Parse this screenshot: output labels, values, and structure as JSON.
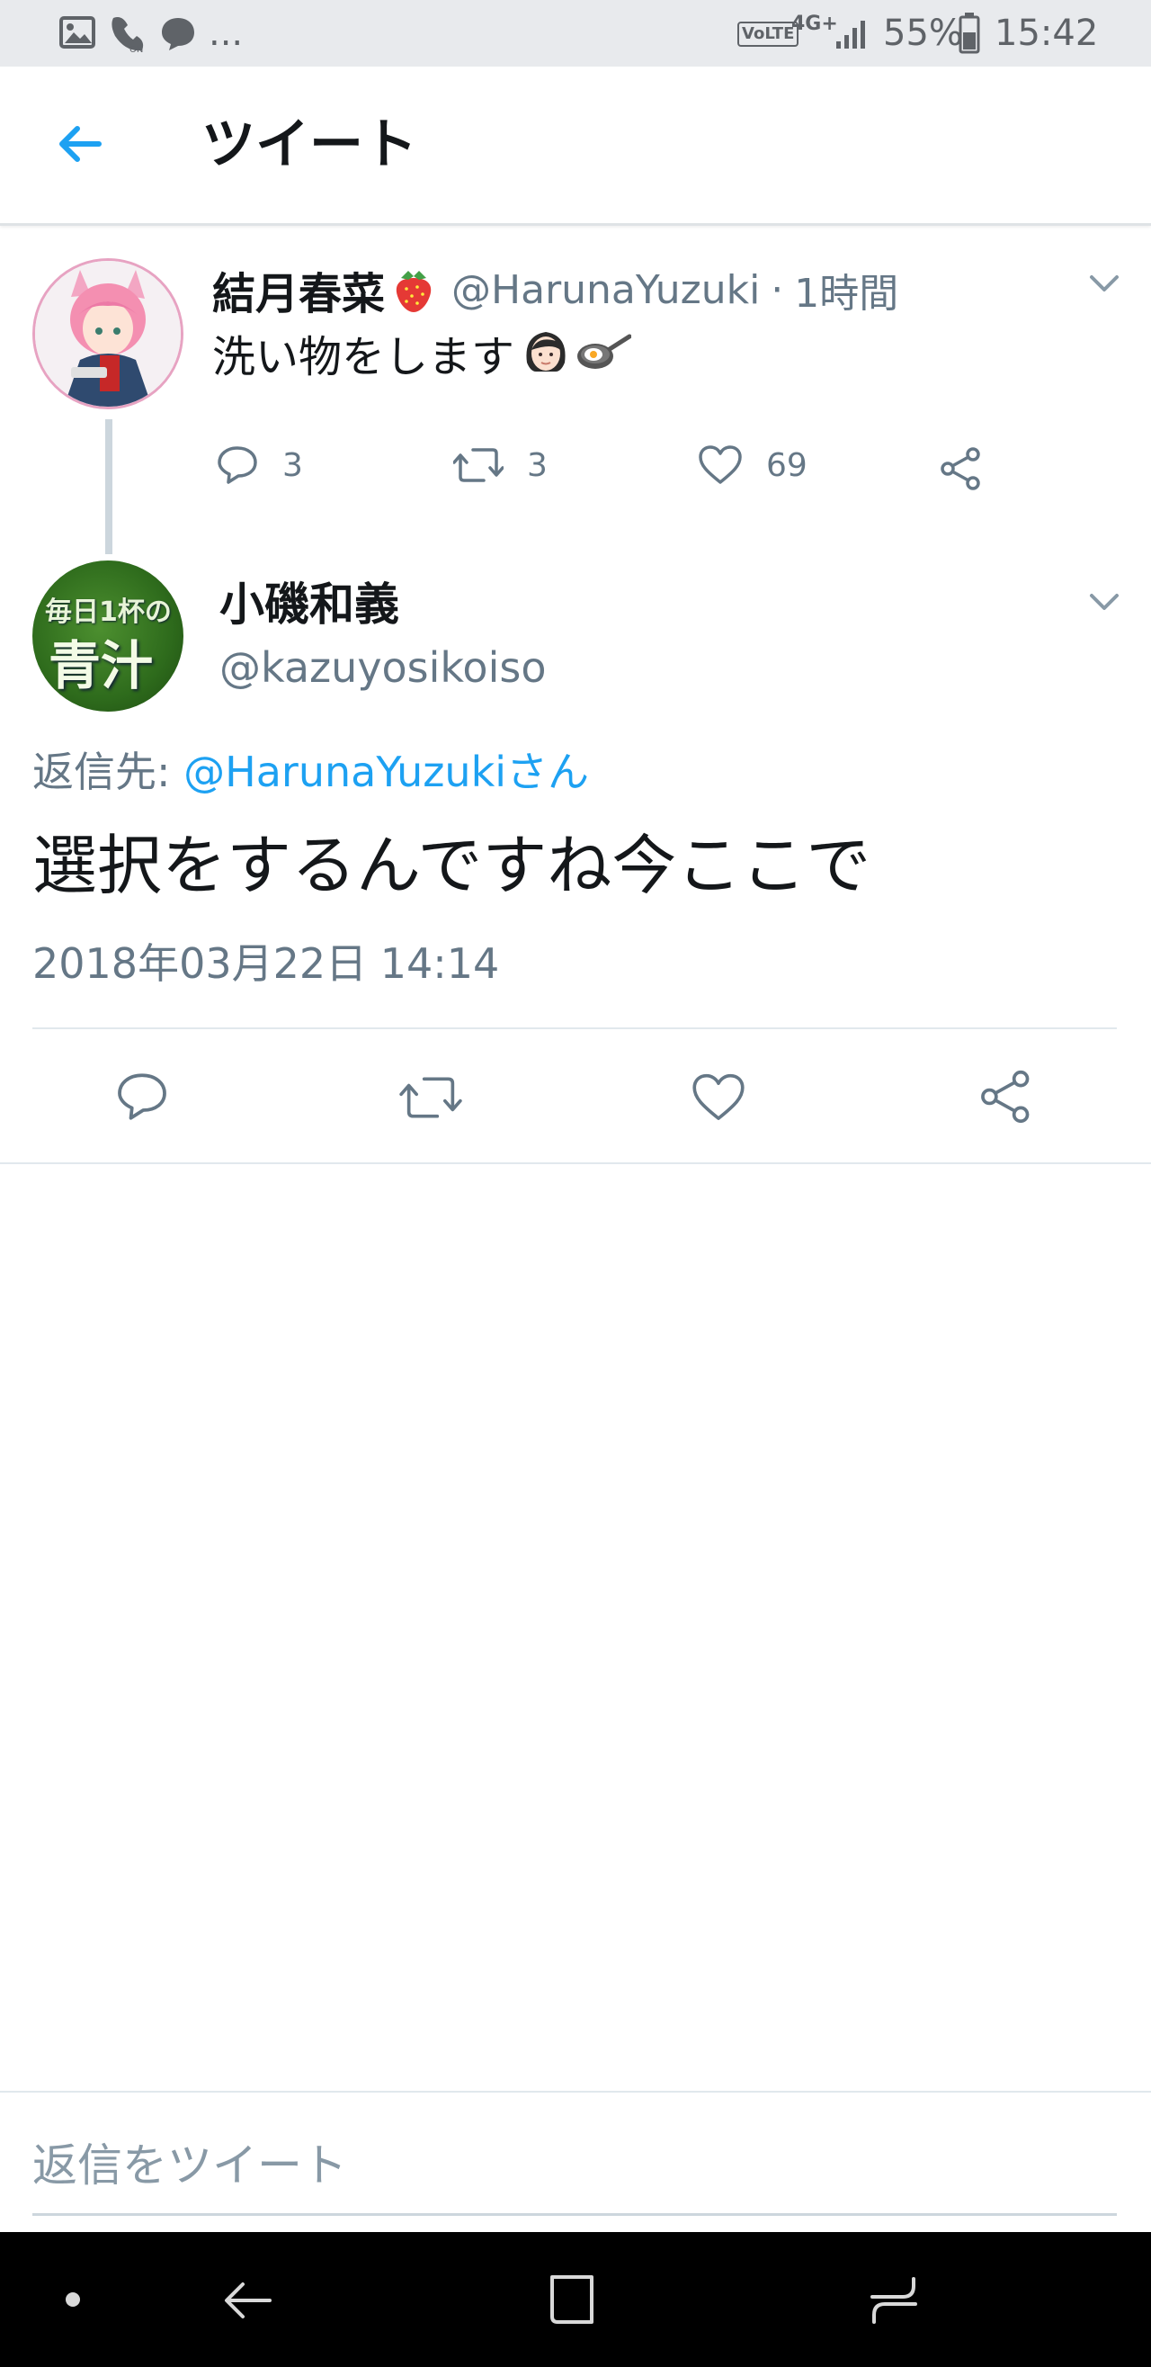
{
  "status_bar": {
    "battery": "55%",
    "time": "15:42",
    "network": "4G+",
    "volte": "VoLTE",
    "overflow": "..."
  },
  "header": {
    "title": "ツイート"
  },
  "parent_tweet": {
    "display_name": "結月春菜",
    "handle": "@HarunaYuzuki",
    "separator": "·",
    "time": "1時間",
    "text": "洗い物をします",
    "replies": "3",
    "retweets": "3",
    "likes": "69"
  },
  "reply_tweet": {
    "display_name": "小磯和義",
    "handle": "@kazuyosikoiso",
    "avatar_text_top": "毎日1杯の",
    "avatar_text_main": "青汁",
    "reply_to_label": "返信先:",
    "reply_to_handle": "@HarunaYuzukiさん",
    "text": "選択をするんですね今ここで",
    "timestamp": "2018年03月22日 14:14"
  },
  "compose": {
    "placeholder": "返信をツイート"
  },
  "colors": {
    "accent": "#1da1f2",
    "muted": "#657786",
    "divider": "#e1e8ed"
  },
  "icons": [
    "gallery-icon",
    "wifi-call-icon",
    "chat-icon",
    "back-arrow-icon",
    "strawberry-icon",
    "woman-emoji-icon",
    "frying-pan-icon",
    "reply-icon",
    "retweet-icon",
    "like-icon",
    "share-icon",
    "chevron-down-icon",
    "nav-dot-icon",
    "nav-back-icon",
    "nav-home-icon",
    "nav-recents-icon"
  ]
}
